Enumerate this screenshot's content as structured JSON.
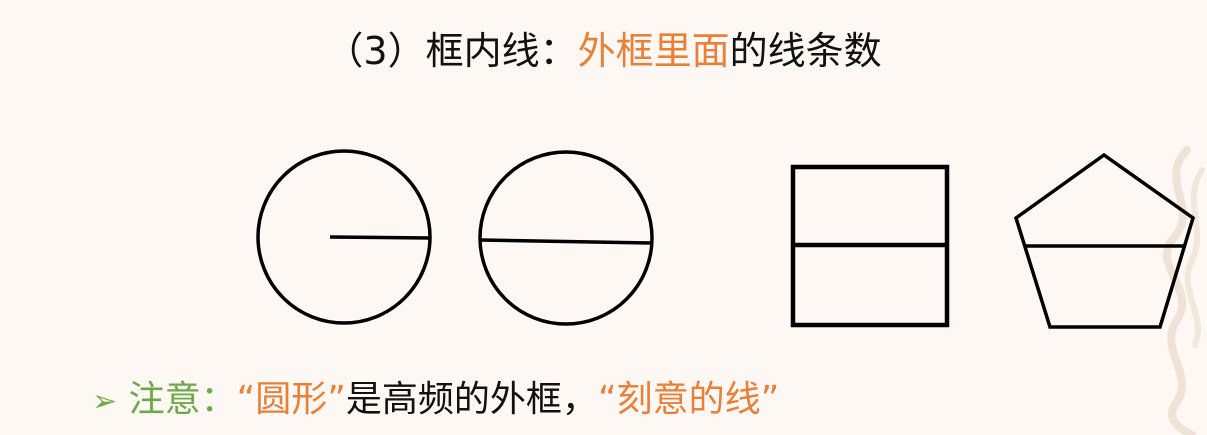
{
  "title": {
    "prefix": "（3）框内线：",
    "highlight": "外框里面",
    "suffix": "的线条数"
  },
  "note": {
    "bullet": "➢",
    "label": "注意：",
    "quote1": "“圆形”",
    "middle": "是高频的外框，",
    "quote2": "“刻意的线”"
  },
  "colors": {
    "highlight": "#e8803a",
    "note_label": "#6fa84a",
    "text": "#111111",
    "stroke": "#000000"
  }
}
